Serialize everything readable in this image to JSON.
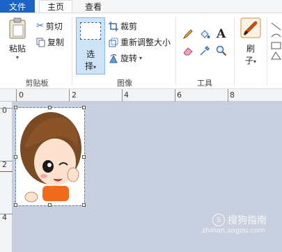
{
  "tabs": {
    "file": "文件",
    "home": "主页",
    "view": "查看"
  },
  "clipboard": {
    "paste": "粘贴",
    "cut": "剪切",
    "copy": "复制",
    "group": "剪贴板"
  },
  "image": {
    "select_line1": "选",
    "select_line2": "择",
    "crop": "裁剪",
    "resize": "重新调整大小",
    "rotate": "旋转",
    "group": "图像"
  },
  "tools": {
    "group": "工具"
  },
  "brushes": {
    "label_line1": "刷",
    "label_line2": "子"
  },
  "ruler": {
    "top": [
      "0",
      "2",
      "4",
      "6",
      "8"
    ],
    "left": [
      "0",
      "2",
      "4"
    ]
  },
  "watermark": {
    "brand": "搜狗指南",
    "url": "zhinan.sogou.com"
  },
  "colors": {
    "file_tab": "#1a63c7",
    "workspace": "#c8d0df",
    "selection": "#cde3f7"
  }
}
